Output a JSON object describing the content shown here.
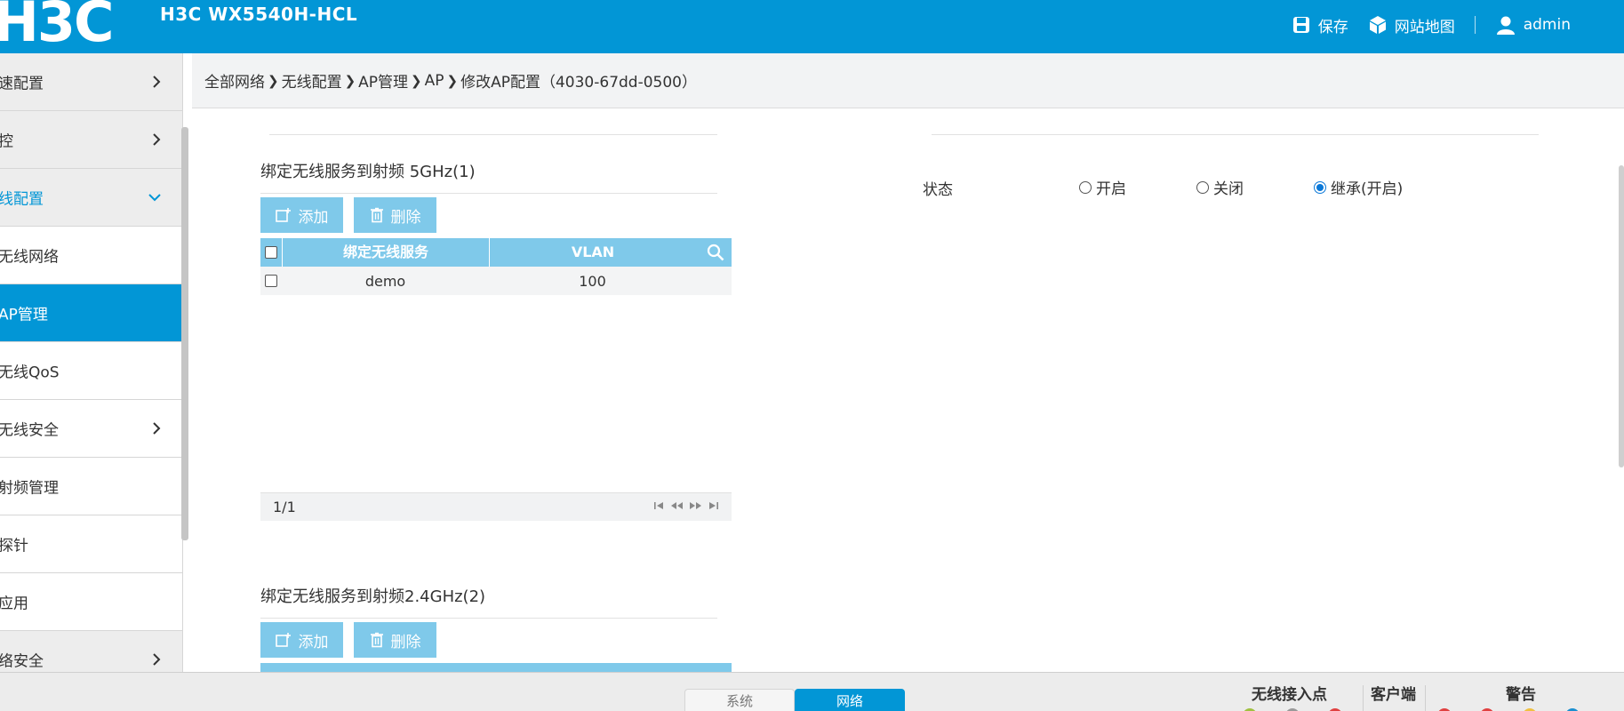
{
  "header": {
    "logo": "H3C",
    "product": "H3C WX5540H-HCL",
    "save_label": "保存",
    "sitemap_label": "网站地图",
    "user_label": "admin"
  },
  "sidebar": {
    "items": [
      {
        "label": "快速配置",
        "display": "速配置"
      },
      {
        "label": "监控",
        "display": "控"
      },
      {
        "label": "无线配置",
        "display": "线配置"
      },
      {
        "label": "无线网络",
        "display": "无线网络"
      },
      {
        "label": "AP管理",
        "display": "AP管理"
      },
      {
        "label": "无线QoS",
        "display": "无线QoS"
      },
      {
        "label": "无线安全",
        "display": "无线安全"
      },
      {
        "label": "射频管理",
        "display": "射频管理"
      },
      {
        "label": "探针",
        "display": "探针"
      },
      {
        "label": "应用",
        "display": "应用"
      },
      {
        "label": "网络安全",
        "display": "络安全"
      }
    ]
  },
  "breadcrumb": {
    "items": [
      "全部网络",
      "无线配置",
      "AP管理",
      "AP",
      "修改AP配置（4030-67dd-0500）"
    ]
  },
  "sections": {
    "radio5g": {
      "title": "绑定无线服务到射频 5GHz(1)",
      "add_label": "添加",
      "delete_label": "删除",
      "columns": [
        "绑定无线服务",
        "VLAN"
      ],
      "rows": [
        {
          "service": "demo",
          "vlan": "100"
        }
      ],
      "pager_text": "1/1"
    },
    "radio24g": {
      "title": "绑定无线服务到射频2.4GHz(2)",
      "add_label": "添加",
      "delete_label": "删除"
    }
  },
  "state": {
    "label": "状态",
    "options": [
      "开启",
      "关闭",
      "继承(开启)"
    ],
    "selected": "继承(开启)"
  },
  "bottom": {
    "tabs": [
      "系统",
      "网络"
    ],
    "active_tab": "网络",
    "stats": [
      "无线接入点",
      "客户端",
      "警告"
    ]
  },
  "colors": {
    "brand": "#0296d6",
    "button": "#7fc9ea"
  }
}
